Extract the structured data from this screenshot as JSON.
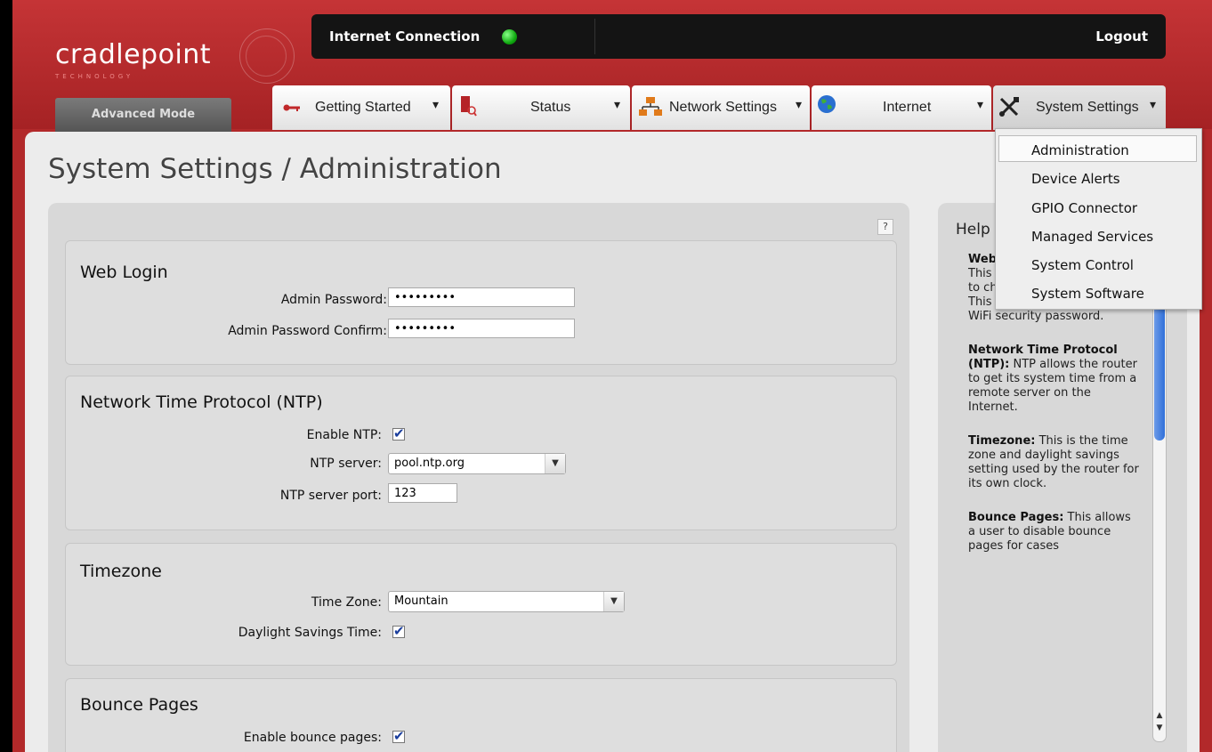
{
  "header": {
    "logo_text": "cradlepoint",
    "logo_sub": "TECHNOLOGY",
    "connection_label": "Internet Connection",
    "connection_status_color": "#22bb22",
    "logout_label": "Logout",
    "mode_label": "Advanced Mode"
  },
  "nav": {
    "getting_started": "Getting Started",
    "status": "Status",
    "network_settings": "Network Settings",
    "internet": "Internet",
    "system_settings": "System Settings"
  },
  "dropdown": {
    "items": [
      "Administration",
      "Device Alerts",
      "GPIO Connector",
      "Managed Services",
      "System Control",
      "System Software"
    ]
  },
  "page": {
    "title": "System Settings / Administration",
    "help_button": "?"
  },
  "web_login": {
    "title": "Web Login",
    "admin_password_label": "Admin Password:",
    "admin_password_value": "•••••••••",
    "admin_password_confirm_label": "Admin Password Confirm:",
    "admin_password_confirm_value": "•••••••••"
  },
  "ntp": {
    "title": "Network Time Protocol (NTP)",
    "enable_label": "Enable NTP:",
    "enable_checked": true,
    "server_label": "NTP server:",
    "server_value": "pool.ntp.org",
    "port_label": "NTP server port:",
    "port_value": "123"
  },
  "timezone": {
    "title": "Timezone",
    "zone_label": "Time Zone:",
    "zone_value": "Mountain",
    "dst_label": "Daylight Savings Time:",
    "dst_checked": true
  },
  "bounce": {
    "title": "Bounce Pages",
    "enable_label": "Enable bounce pages:",
    "enable_checked": true
  },
  "help": {
    "title": "Help",
    "p1_bold": "Web",
    "p1_text": "passw admir password. This password allows a user to change router settings. This is separate from the WiFi security password.",
    "p2_bold": "Network Time Protocol (NTP):",
    "p2_text": " NTP allows the router to get its system time from a remote server on the Internet.",
    "p3_bold": "Timezone:",
    "p3_text": " This is the time zone and daylight savings setting used by the router for its own clock.",
    "p4_bold": "Bounce Pages:",
    "p4_text": " This allows a user to disable bounce pages for cases"
  }
}
